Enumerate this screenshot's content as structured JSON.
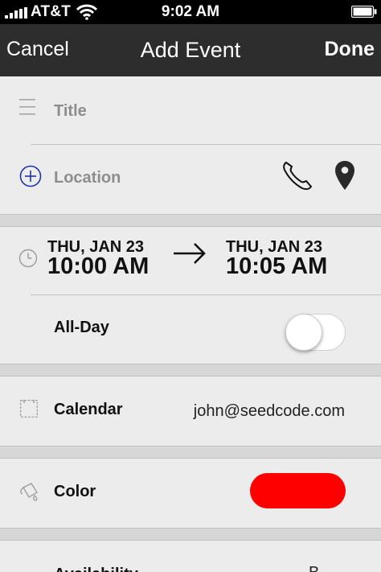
{
  "status_bar": {
    "carrier": "AT&T",
    "time": "9:02 AM",
    "signal_icon": "signal-bars-icon",
    "wifi_icon": "wifi-icon",
    "battery_icon": "battery-icon"
  },
  "nav": {
    "cancel_label": "Cancel",
    "title": "Add Event",
    "done_label": "Done"
  },
  "form": {
    "title_placeholder": "Title",
    "location_placeholder": "Location",
    "start": {
      "day": "THU, JAN 23",
      "time": "10:00 AM"
    },
    "end": {
      "day": "THU, JAN 23",
      "time": "10:05 AM"
    },
    "all_day_label": "All-Day",
    "all_day_on": false,
    "calendar_label": "Calendar",
    "calendar_value": "john@seedcode.com",
    "color_label": "Color",
    "color_value": "#ff0000",
    "availability_label": "Availability",
    "availability_value": "B"
  },
  "colors": {
    "nav_background": "#2d2d2d",
    "accent_blue": "#2233aa",
    "event_color": "#ff0000"
  }
}
